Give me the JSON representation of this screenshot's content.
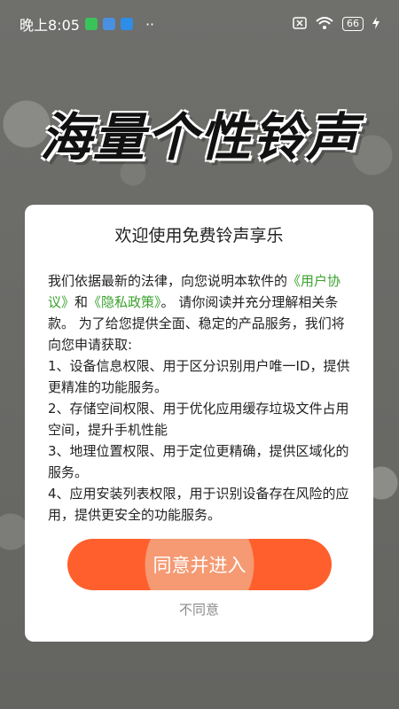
{
  "status_bar": {
    "time": "晚上8:05",
    "more": "··",
    "battery": "66"
  },
  "hero_title": "海量个性铃声",
  "dialog": {
    "title": "欢迎使用免费铃声享乐",
    "intro_prefix": "我们依据最新的法律，向您说明本软件的",
    "user_agreement_link": "《用户协议》",
    "and_text": "和",
    "privacy_link": "《隐私政策》",
    "intro_suffix": "。 请你阅读并充分理解相关条款。 为了给您提供全面、稳定的产品服务，我们将向您申请获取:",
    "items": [
      "1、设备信息权限、用于区分识别用户唯一ID，提供更精准的功能服务。",
      "2、存储空间权限、用于优化应用缓存垃圾文件占用空间，提升手机性能",
      "3、地理位置权限、用于定位更精确，提供区域化的服务。",
      "4、应用安装列表权限，用于识别设备存在风险的应用，提供更安全的功能服务。"
    ],
    "agree_button": "同意并进入",
    "disagree_button": "不同意"
  },
  "colors": {
    "accent": "#ff5f2c",
    "link": "#3aa12e",
    "dialog_bg": "#ffffff"
  }
}
